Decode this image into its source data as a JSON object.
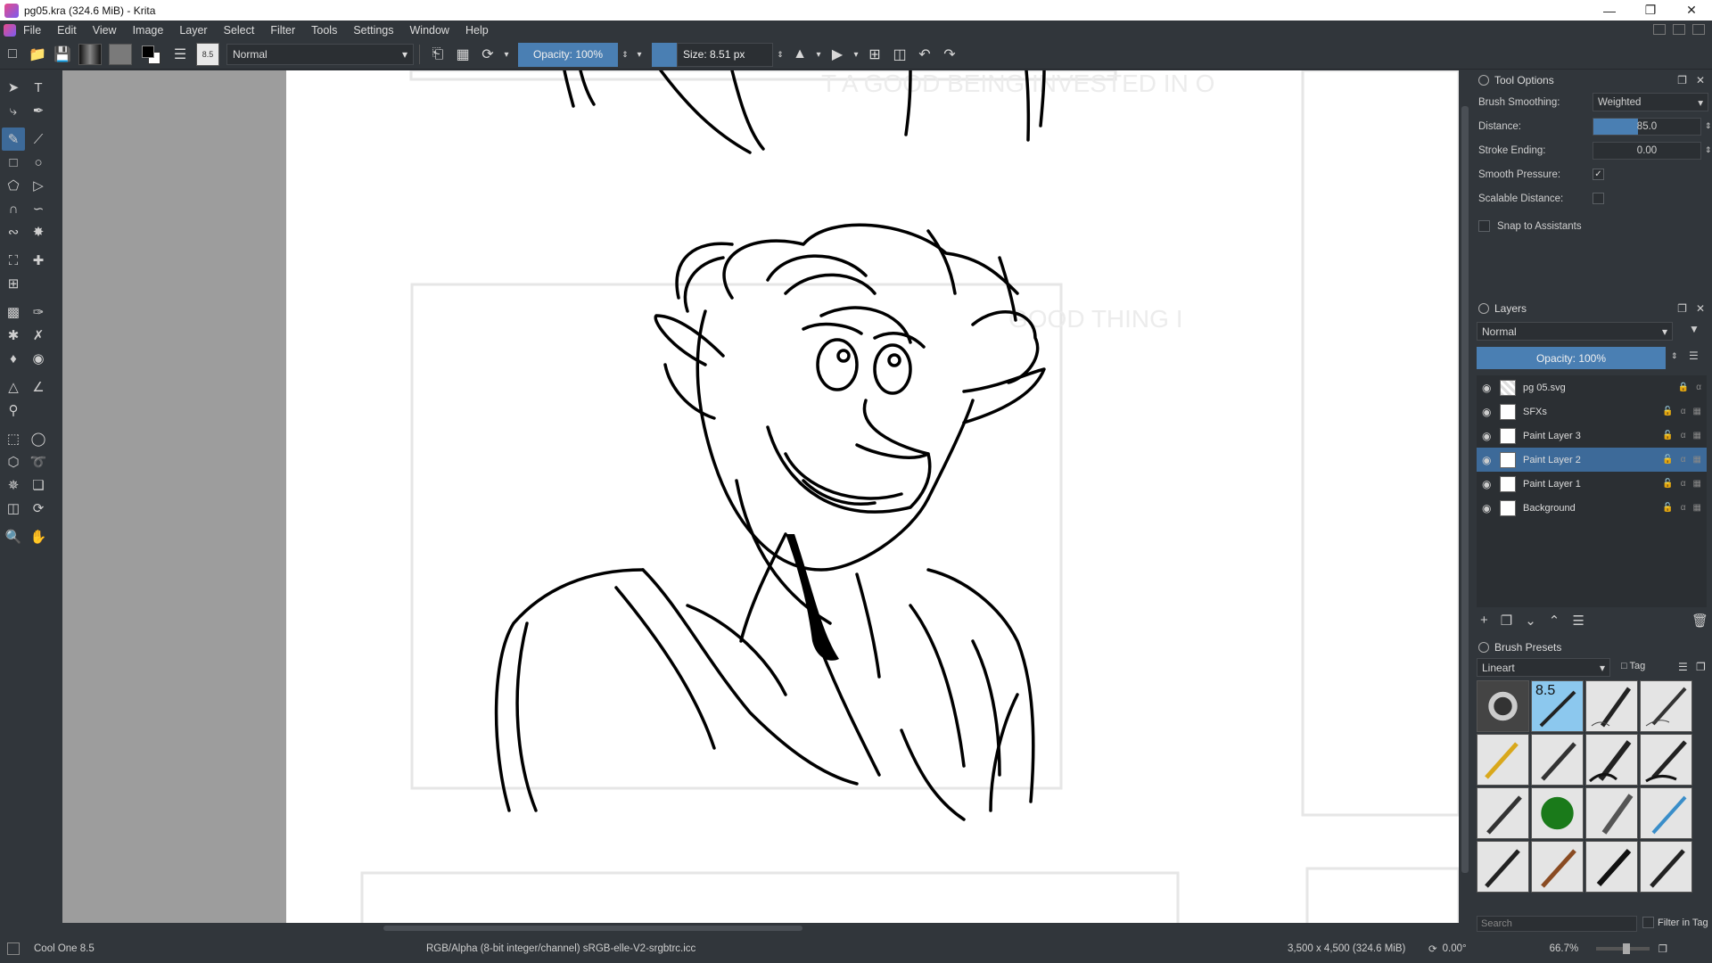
{
  "window": {
    "title": "pg05.kra (324.6 MiB) - Krita"
  },
  "menu": [
    "File",
    "Edit",
    "View",
    "Image",
    "Layer",
    "Select",
    "Filter",
    "Tools",
    "Settings",
    "Window",
    "Help"
  ],
  "toolbar": {
    "blend_mode": "Normal",
    "opacity_label": "Opacity: 100%",
    "size_label": "Size: 8.51 px",
    "preset_thumb_text": "8.5"
  },
  "tool_options": {
    "title": "Tool Options",
    "brush_smoothing_label": "Brush Smoothing:",
    "brush_smoothing_value": "Weighted",
    "distance_label": "Distance:",
    "distance_value": "85.0",
    "distance_fraction": 0.42,
    "stroke_ending_label": "Stroke Ending:",
    "stroke_ending_value": "0.00",
    "smooth_pressure_label": "Smooth Pressure:",
    "scalable_distance_label": "Scalable Distance:",
    "snap_label": "Snap to Assistants"
  },
  "layers": {
    "title": "Layers",
    "blend_mode": "Normal",
    "opacity_label": "Opacity:  100%",
    "items": [
      {
        "name": "pg 05.svg"
      },
      {
        "name": "SFXs"
      },
      {
        "name": "Paint Layer 3"
      },
      {
        "name": "Paint Layer 2"
      },
      {
        "name": "Paint Layer 1"
      },
      {
        "name": "Background"
      }
    ]
  },
  "brush_presets": {
    "title": "Brush Presets",
    "tag": "Lineart",
    "tag_button": "Tag",
    "search_placeholder": "Search",
    "filter_label": "Filter in Tag",
    "selected_label": "8.5"
  },
  "canvas": {
    "bg_text_1": "T A GOOD BEING INVESTED IN O",
    "bg_text_2": "GOOD THING I"
  },
  "status": {
    "preset_name": "Cool One 8.5",
    "color_profile": "RGB/Alpha (8-bit integer/channel)  sRGB-elle-V2-srgbtrc.icc",
    "dimensions": "3,500 x 4,500 (324.6 MiB)",
    "rotation": "0.00°",
    "zoom": "66.7%"
  }
}
